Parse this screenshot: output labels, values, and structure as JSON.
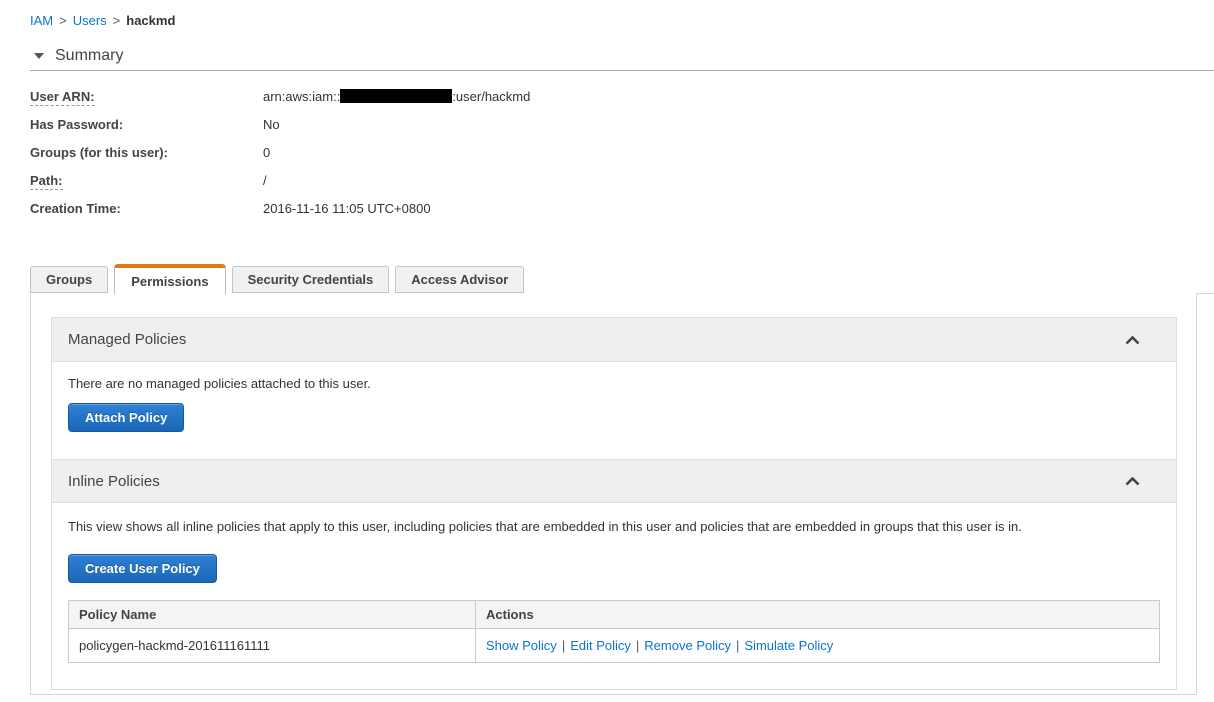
{
  "breadcrumb": {
    "separator": ">",
    "items": [
      {
        "label": "IAM"
      },
      {
        "label": "Users"
      },
      {
        "label": "hackmd"
      }
    ]
  },
  "summary": {
    "title": "Summary",
    "fields": [
      {
        "label": "User ARN:",
        "value_prefix": "arn:aws:iam::",
        "value_redacted": true,
        "value_suffix": ":user/hackmd"
      },
      {
        "label": "Has Password:",
        "value": "No"
      },
      {
        "label": "Groups (for this user):",
        "value": "0"
      },
      {
        "label": "Path:",
        "value": "/"
      },
      {
        "label": "Creation Time:",
        "value": "2016-11-16 11:05 UTC+0800"
      }
    ]
  },
  "tabs": [
    {
      "label": "Groups",
      "active": false
    },
    {
      "label": "Permissions",
      "active": true
    },
    {
      "label": "Security Credentials",
      "active": false
    },
    {
      "label": "Access Advisor",
      "active": false
    }
  ],
  "managed_policies": {
    "title": "Managed Policies",
    "empty_message": "There are no managed policies attached to this user.",
    "attach_button_label": "Attach Policy",
    "collapse_icon": "chevron-up"
  },
  "inline_policies": {
    "title": "Inline Policies",
    "description": "This view shows all inline policies that apply to this user, including policies that are embedded in this user and policies that are embedded in groups that this user is in.",
    "create_button_label": "Create User Policy",
    "collapse_icon": "chevron-up",
    "table": {
      "columns": [
        "Policy Name",
        "Actions"
      ],
      "action_separator": "|",
      "rows": [
        {
          "policy_name": "policygen-hackmd-201611161111",
          "actions": [
            "Show Policy",
            "Edit Policy",
            "Remove Policy",
            "Simulate Policy"
          ]
        }
      ]
    }
  },
  "colors": {
    "accent_orange": "#e47911",
    "link_blue": "#0d73cc",
    "button_blue_top": "#2f82d4",
    "button_blue_bottom": "#1a66b8"
  }
}
